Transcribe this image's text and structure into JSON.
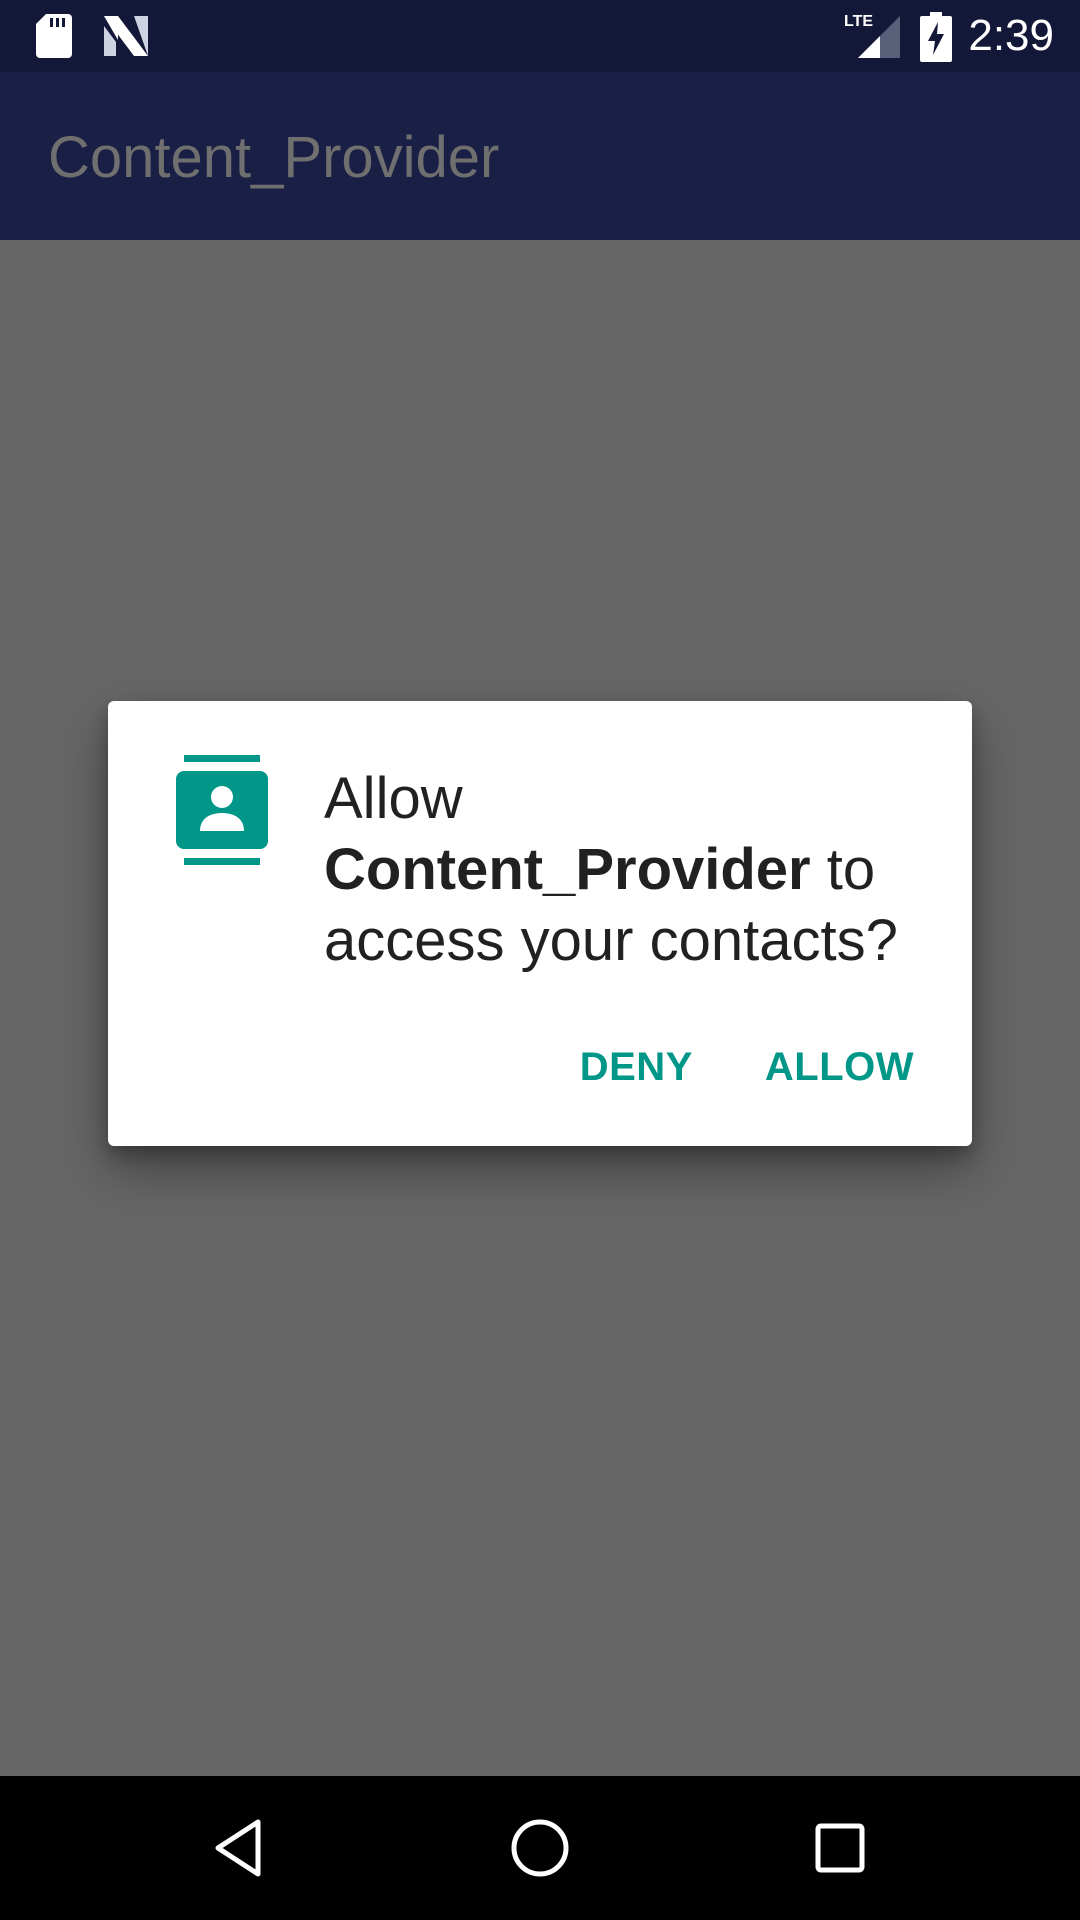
{
  "status_bar": {
    "time": "2:39",
    "network_label": "LTE",
    "icons": [
      "sd-card-icon",
      "n-notification-icon",
      "lte-signal-icon",
      "battery-charging-icon"
    ]
  },
  "app_bar": {
    "title": "Content_Provider"
  },
  "dialog": {
    "icon": "contacts-icon",
    "message_prefix": "Allow",
    "app_name": "Content_Provider",
    "message_suffix": "to access your contacts?",
    "deny_label": "DENY",
    "allow_label": "ALLOW"
  },
  "nav_bar": {
    "icons": [
      "back-icon",
      "home-icon",
      "recents-icon"
    ]
  },
  "colors": {
    "status_bar": "#141838",
    "app_bar_dimmed": "#1a1f45",
    "scrim": "#666666",
    "accent": "#009688",
    "dialog_text": "#212121"
  }
}
